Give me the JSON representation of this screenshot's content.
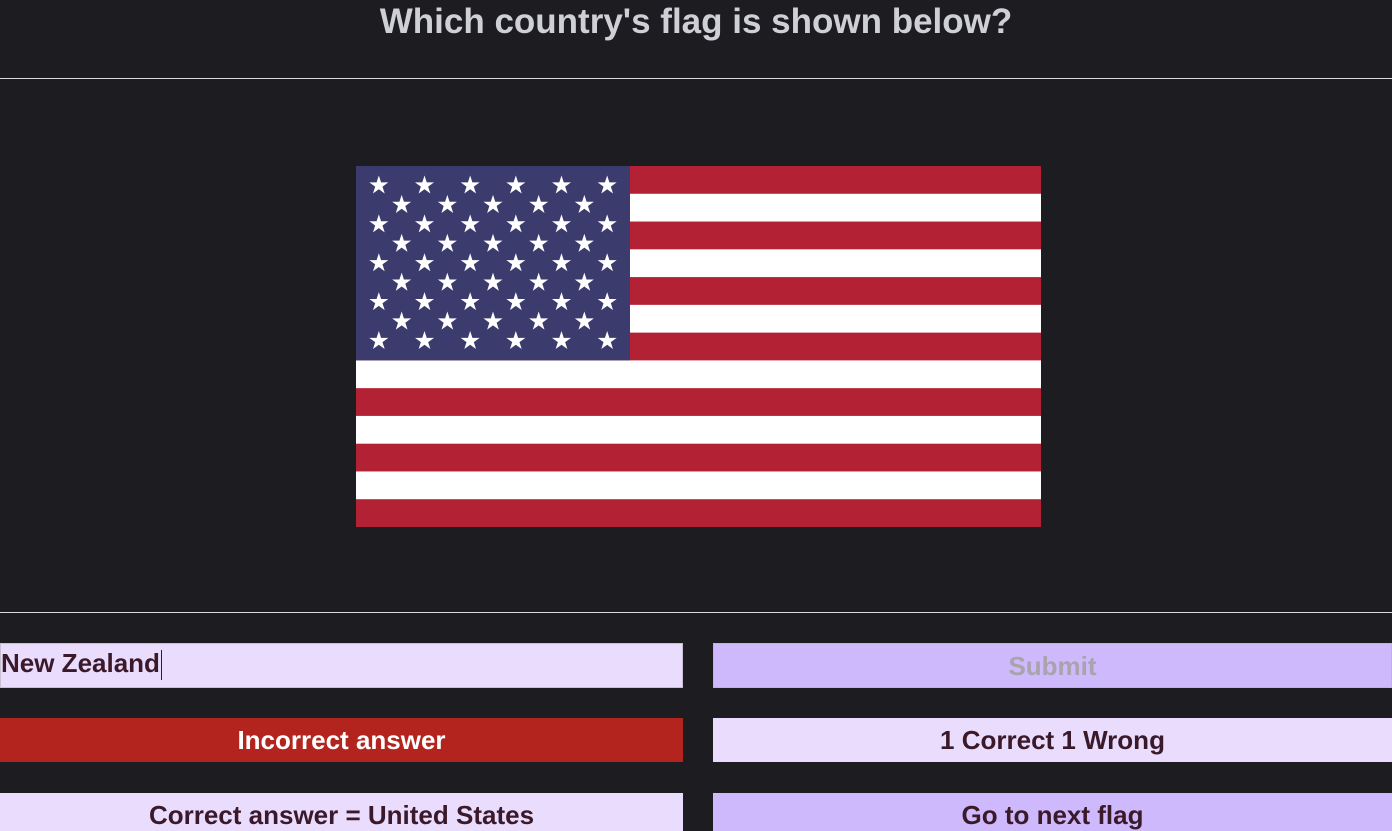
{
  "quiz": {
    "question": "Which country's flag is shown below?",
    "flag": {
      "description_icon": "united-states-flag",
      "colors": {
        "red": "#b22234",
        "white": "#ffffff",
        "blue": "#3c3b6e"
      }
    }
  },
  "answer": {
    "input_value": "New Zealand",
    "submit_label": "Submit"
  },
  "result": {
    "feedback": "Incorrect answer",
    "score": "1 Correct 1 Wrong",
    "correct_answer": "Correct answer = United States",
    "next_label": "Go to next flag"
  },
  "colors": {
    "background": "#1d1c20",
    "incorrect": "#b3241e",
    "light_lavender": "#e9dcfc",
    "lavender": "#cdb9fb"
  }
}
